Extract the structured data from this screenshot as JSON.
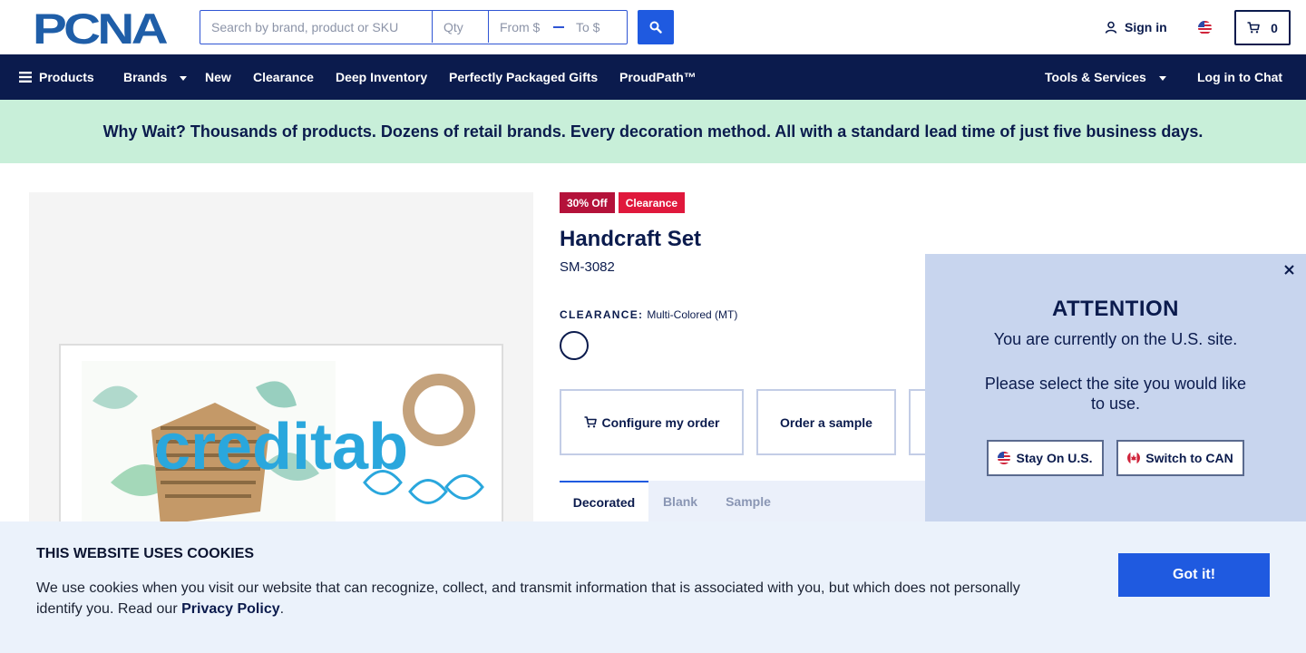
{
  "header": {
    "logo_text": "PCNA",
    "search": {
      "placeholder": "Search by brand, product or SKU",
      "qty_placeholder": "Qty",
      "from_placeholder": "From $",
      "to_placeholder": "To $"
    },
    "sign_in_label": "Sign in",
    "cart_count": "0"
  },
  "nav": {
    "products": "Products",
    "brands": "Brands",
    "new": "New",
    "clearance": "Clearance",
    "deep_inventory": "Deep Inventory",
    "gifts": "Perfectly Packaged Gifts",
    "proudpath": "ProudPath™",
    "tools": "Tools & Services",
    "chat": "Log in to Chat"
  },
  "promo": {
    "text": "Why Wait? Thousands of products. Dozens of retail brands. Every decoration method. All with a standard lead time of just five business days."
  },
  "product": {
    "image_logo_text": "creditab",
    "badges": [
      "30% Off",
      "Clearance"
    ],
    "title": "Handcraft Set",
    "sku": "SM-3082",
    "clearance_label": "CLEARANCE:",
    "clearance_value": "Multi-Colored (MT)",
    "actions": {
      "configure": "Configure my order",
      "sample": "Order a sample"
    },
    "tabs": [
      "Decorated",
      "Blank",
      "Sample"
    ]
  },
  "attention": {
    "title": "ATTENTION",
    "line1": "You are currently on the U.S. site.",
    "line2": "Please select the site you would like to use.",
    "stay_label": "Stay On U.S.",
    "switch_label": "Switch to CAN"
  },
  "cookie": {
    "title": "THIS WEBSITE USES COOKIES",
    "text": "We use cookies when you visit our website that can recognize, collect, and transmit information that is associated with you, but which does not personally identify you. Read our ",
    "link": "Privacy Policy",
    "after": ".",
    "button": "Got it!"
  },
  "colors": {
    "navy": "#0b1b4d",
    "accent_blue": "#1f5ae0",
    "promo_bg": "#c8efd9",
    "badge_red": "#b4123a"
  },
  "icons": [
    "menu-icon",
    "search-icon",
    "user-icon",
    "us-flag-icon",
    "cart-icon",
    "close-icon",
    "canada-flag-icon"
  ]
}
